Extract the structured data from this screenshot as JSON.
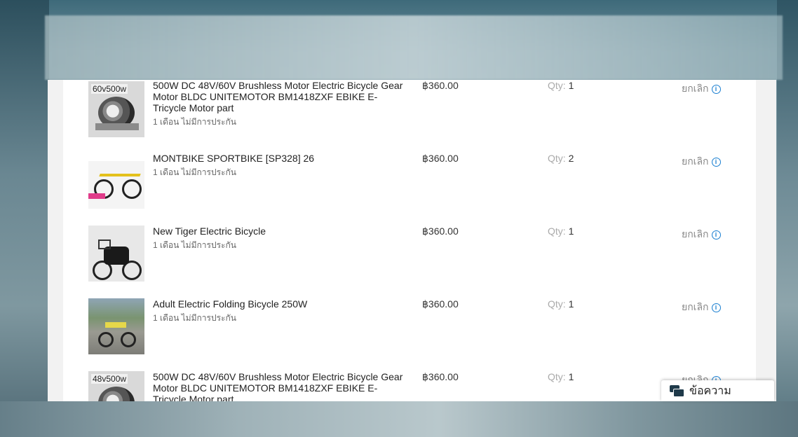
{
  "items": [
    {
      "tag": "60v500w",
      "title": "500W DC 48V/60V Brushless Motor Electric Bicycle Gear Motor BLDC UNITEMOTOR BM1418ZXF EBIKE E-Tricycle Motor part",
      "warranty": "1 เดือน ไม่มีการประกัน",
      "price": "฿360.00",
      "qty_label": "Qty:",
      "qty": "1",
      "cancel": "ยกเลิก"
    },
    {
      "tag": "",
      "title": "MONTBIKE SPORTBIKE [SP328] 26",
      "warranty": "1 เดือน ไม่มีการประกัน",
      "price": "฿360.00",
      "qty_label": "Qty:",
      "qty": "2",
      "cancel": "ยกเลิก"
    },
    {
      "tag": "",
      "title": "New Tiger Electric Bicycle",
      "warranty": "1 เดือน ไม่มีการประกัน",
      "price": "฿360.00",
      "qty_label": "Qty:",
      "qty": "1",
      "cancel": "ยกเลิก"
    },
    {
      "tag": "",
      "title": "Adult Electric Folding Bicycle 250W",
      "warranty": "1 เดือน ไม่มีการประกัน",
      "price": "฿360.00",
      "qty_label": "Qty:",
      "qty": "1",
      "cancel": "ยกเลิก"
    },
    {
      "tag": "48v500w",
      "title": "500W DC 48V/60V Brushless Motor Electric Bicycle Gear Motor BLDC UNITEMOTOR BM1418ZXF EBIKE E-Tricycle Motor part",
      "warranty": "",
      "price": "฿360.00",
      "qty_label": "Qty:",
      "qty": "1",
      "cancel": "ยกเลิก"
    }
  ],
  "info_icon": "i",
  "chat": {
    "label": "ข้อความ"
  },
  "colors": {
    "info": "#1a7fd1",
    "cancel": "#888888"
  }
}
